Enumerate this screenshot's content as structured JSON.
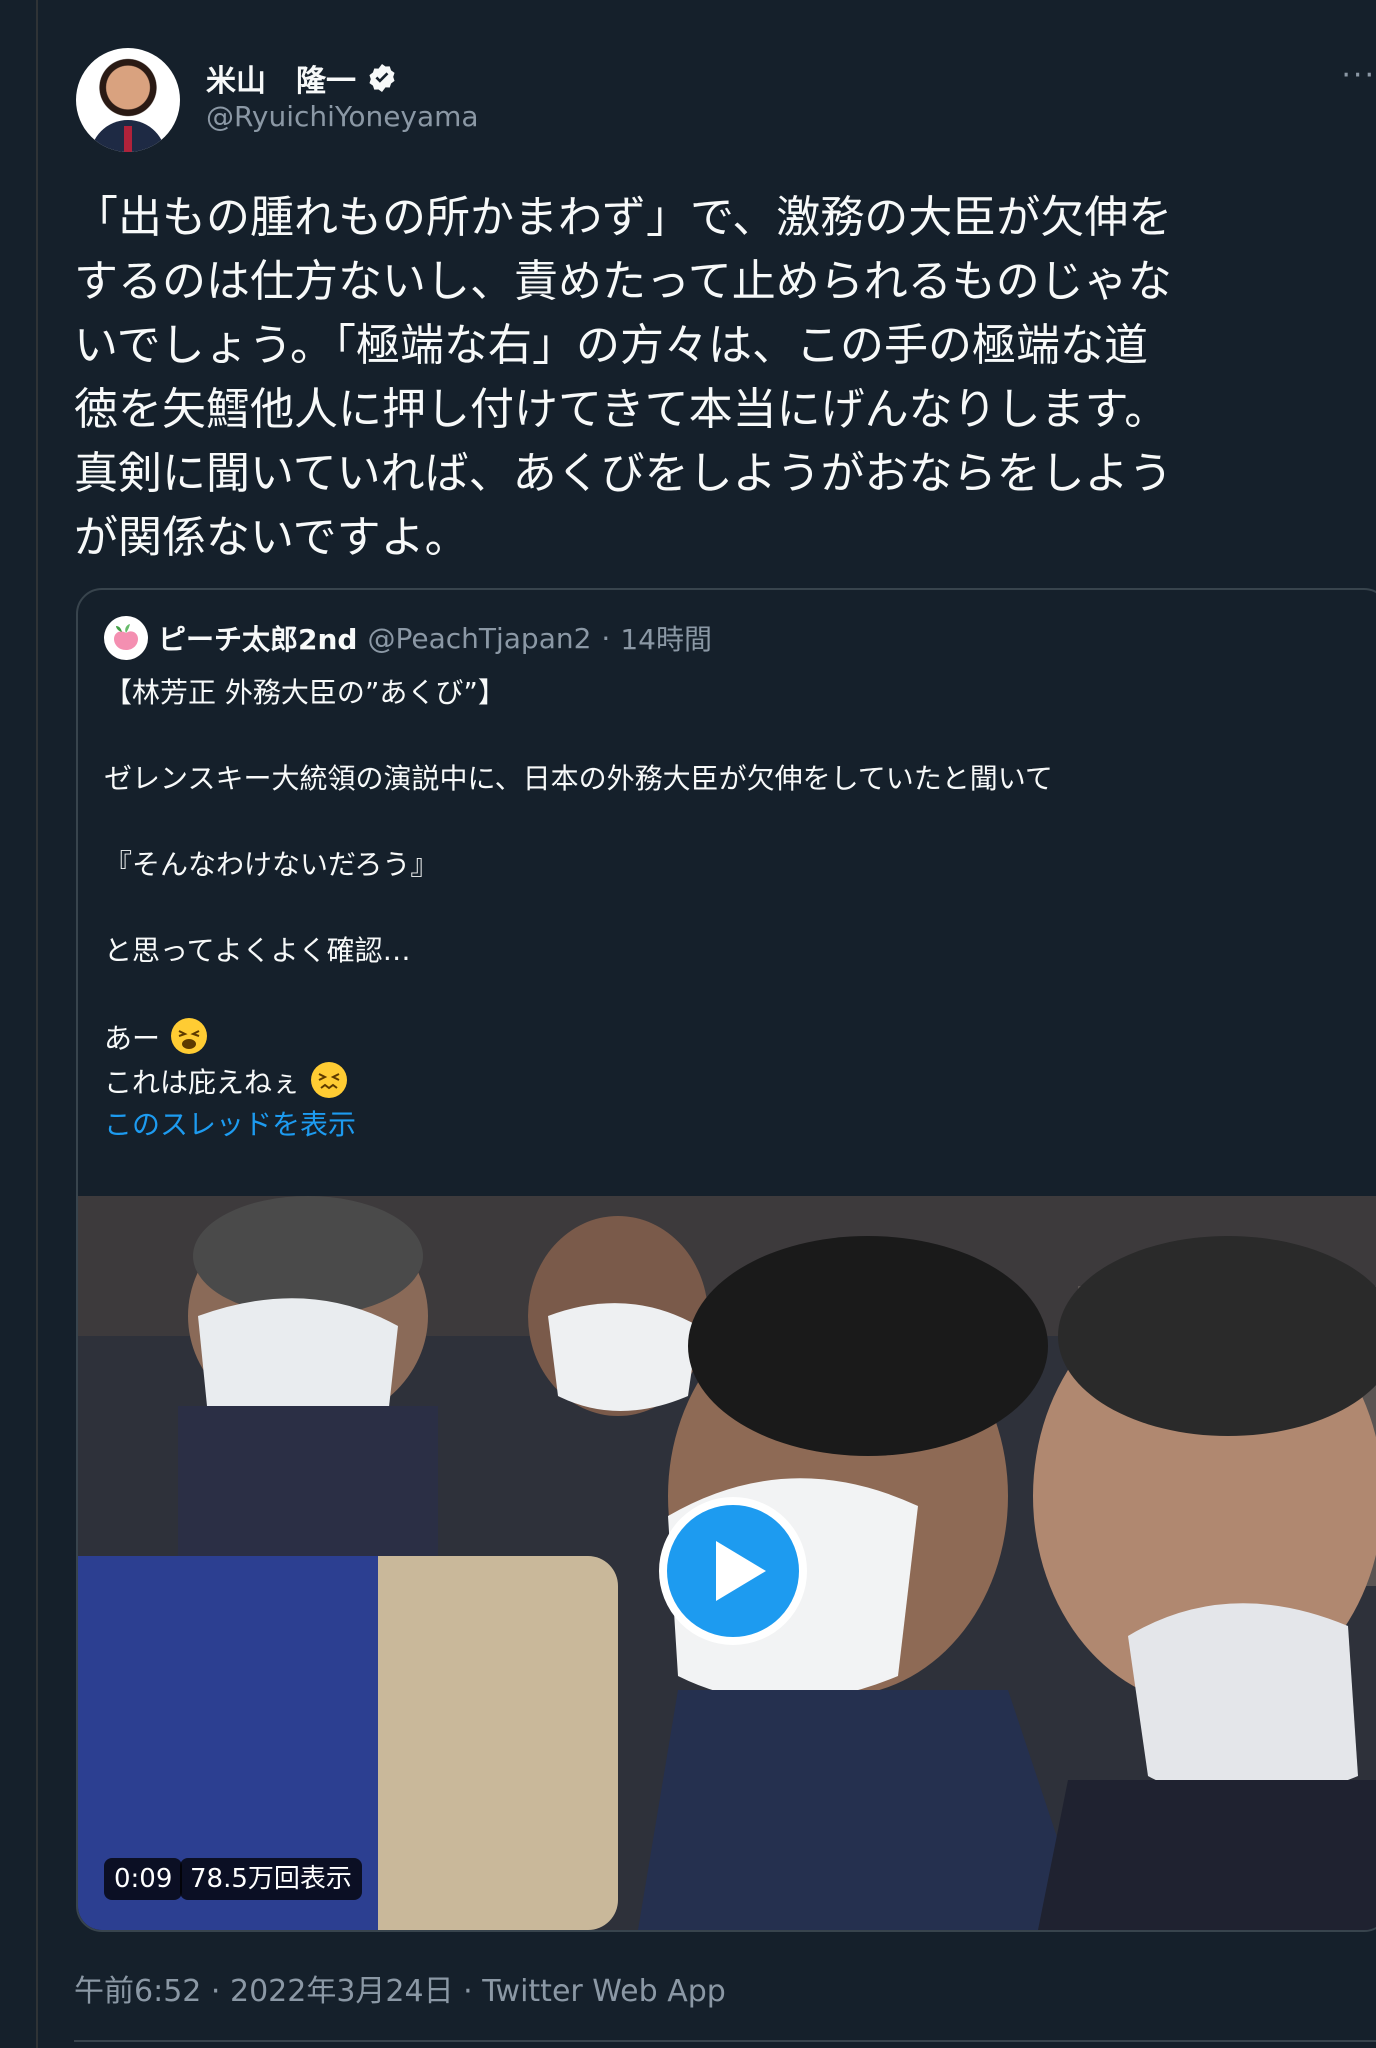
{
  "author": {
    "name": "米山　隆一",
    "handle": "@RyuichiYoneyama",
    "more_label": "···"
  },
  "tweet": {
    "lines": [
      "「出もの腫れもの所かまわず」で、激務の大臣が欠伸を",
      "するのは仕方ないし、責めたって止められるものじゃな",
      "いでしょう。「極端な右」の方々は、この手の極端な道",
      "徳を矢鱈他人に押し付けてきて本当にげんなりします。",
      "真剣に聞いていれば、あくびをしようがおならをしよう",
      "が関係ないですよ。"
    ]
  },
  "quote": {
    "name": "ピーチ太郎2nd",
    "handle": "@PeachTjapan2",
    "separator": "·",
    "time": "14時間",
    "lines": {
      "l1": "【林芳正 外務大臣の”あくび”】",
      "l2": "ゼレンスキー大統領の演説中に、日本の外務大臣が欠伸をしていたと聞いて",
      "l3": "『そんなわけないだろう』",
      "l4": "と思ってよくよく確認…",
      "l5": "あー",
      "l6": "これは庇えねぇ"
    },
    "thread_link": "このスレッドを表示",
    "video": {
      "duration": "0:09",
      "views": "78.5万回表示"
    }
  },
  "footer": {
    "timestamp": "午前6:52 · 2022年3月24日 · Twitter Web App"
  },
  "colors": {
    "background": "#15202b",
    "accent": "#1d9bf0",
    "muted": "#8b98a5"
  }
}
